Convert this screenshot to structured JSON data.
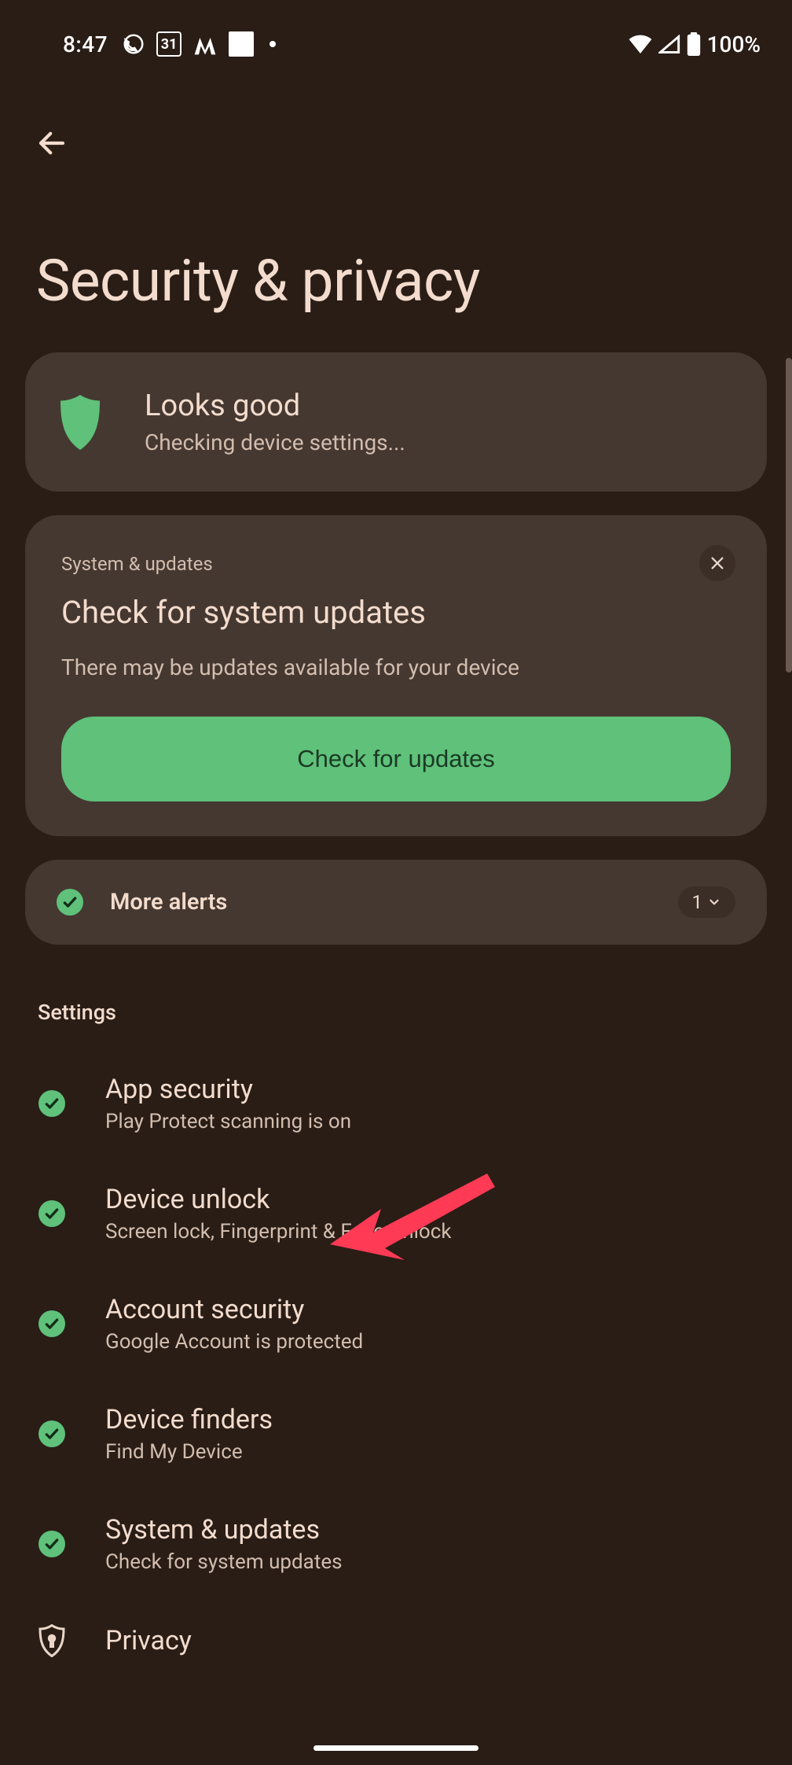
{
  "status_bar": {
    "time": "8:47",
    "calendar_day": "31",
    "battery_text": "100%"
  },
  "header": {
    "page_title": "Security & privacy"
  },
  "status_card": {
    "title": "Looks good",
    "subtitle": "Checking device settings..."
  },
  "update_card": {
    "eyebrow": "System & updates",
    "title": "Check for system updates",
    "description": "There may be updates available for your device",
    "button_label": "Check for updates"
  },
  "alerts": {
    "label": "More alerts",
    "count": "1"
  },
  "sections": {
    "settings_label": "Settings"
  },
  "settings": [
    {
      "title": "App security",
      "subtitle": "Play Protect scanning is on"
    },
    {
      "title": "Device unlock",
      "subtitle": "Screen lock, Fingerprint & Face Unlock"
    },
    {
      "title": "Account security",
      "subtitle": "Google Account is protected"
    },
    {
      "title": "Device finders",
      "subtitle": "Find My Device"
    },
    {
      "title": "System & updates",
      "subtitle": "Check for system updates"
    }
  ],
  "privacy": {
    "title": "Privacy"
  }
}
